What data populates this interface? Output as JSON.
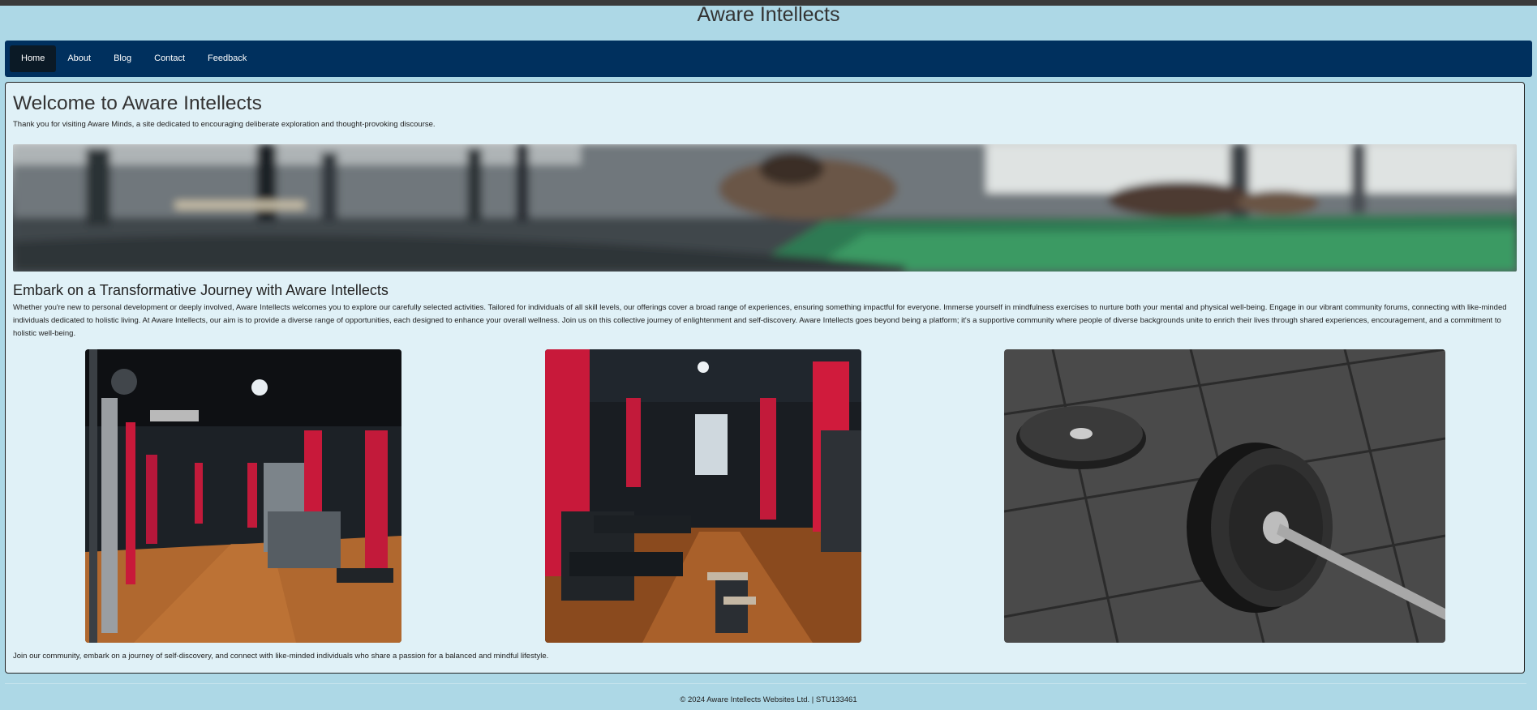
{
  "site": {
    "title": "Aware Intellects"
  },
  "nav": {
    "items": [
      {
        "label": "Home",
        "active": true
      },
      {
        "label": "About",
        "active": false
      },
      {
        "label": "Blog",
        "active": false
      },
      {
        "label": "Contact",
        "active": false
      },
      {
        "label": "Feedback",
        "active": false
      }
    ]
  },
  "main": {
    "heading": "Welcome to Aware Intellects",
    "intro": "Thank you for visiting Aware Minds, a site dedicated to encouraging deliberate exploration and thought-provoking discourse.",
    "section_heading": "Embark on a Transformative Journey with Aware Intellects",
    "section_body": "Whether you're new to personal development or deeply involved, Aware Intellects welcomes you to explore our carefully selected activities. Tailored for individuals of all skill levels, our offerings cover a broad range of experiences, ensuring something impactful for everyone. Immerse yourself in mindfulness exercises to nurture both your mental and physical well-being. Engage in our vibrant community forums, connecting with like-minded individuals dedicated to holistic living. At Aware Intellects, our aim is to provide a diverse range of opportunities, each designed to enhance your overall wellness. Join us on this collective journey of enlightenment and self-discovery. Aware Intellects goes beyond being a platform; it's a supportive community where people of diverse backgrounds unite to enrich their lives through shared experiences, encouragement, and a commitment to holistic well-being.",
    "closing": "Join our community, embark on a journey of self-discovery, and connect with like-minded individuals who share a passion for a balanced and mindful lifestyle."
  },
  "footer": {
    "text": "© 2024 Aware Intellects Websites Ltd. | STU133461"
  },
  "colors": {
    "page_bg": "#add8e6",
    "nav_bg": "#00305e",
    "nav_active_bg": "#0b1a26",
    "panel_bg": "#e0f1f7"
  }
}
